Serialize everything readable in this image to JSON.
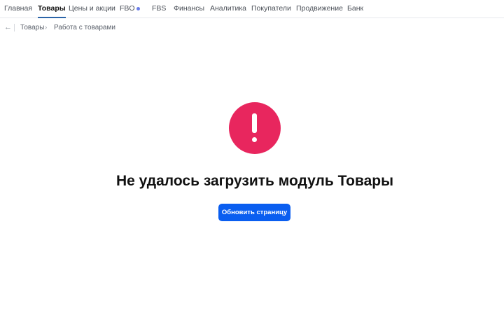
{
  "nav": {
    "items": [
      {
        "label": "Главная"
      },
      {
        "label": "Товары",
        "active": true
      },
      {
        "label": "Цены и акции"
      },
      {
        "label": "FBO",
        "has_dot": true
      },
      {
        "label": "FBS"
      },
      {
        "label": "Финансы"
      },
      {
        "label": "Аналитика"
      },
      {
        "label": "Покупатели"
      },
      {
        "label": "Продвижение"
      },
      {
        "label": "Банк"
      }
    ]
  },
  "breadcrumb": {
    "back_icon": "arrow-left-icon",
    "items": [
      {
        "label": "Товары"
      },
      {
        "label": "Работа с товарами"
      }
    ]
  },
  "error": {
    "icon": "exclamation-circle-icon",
    "icon_color": "#e8265e",
    "title": "Не удалось загрузить модуль Товары",
    "button_label": "Обновить страницу",
    "button_color": "#0a5ef0"
  }
}
